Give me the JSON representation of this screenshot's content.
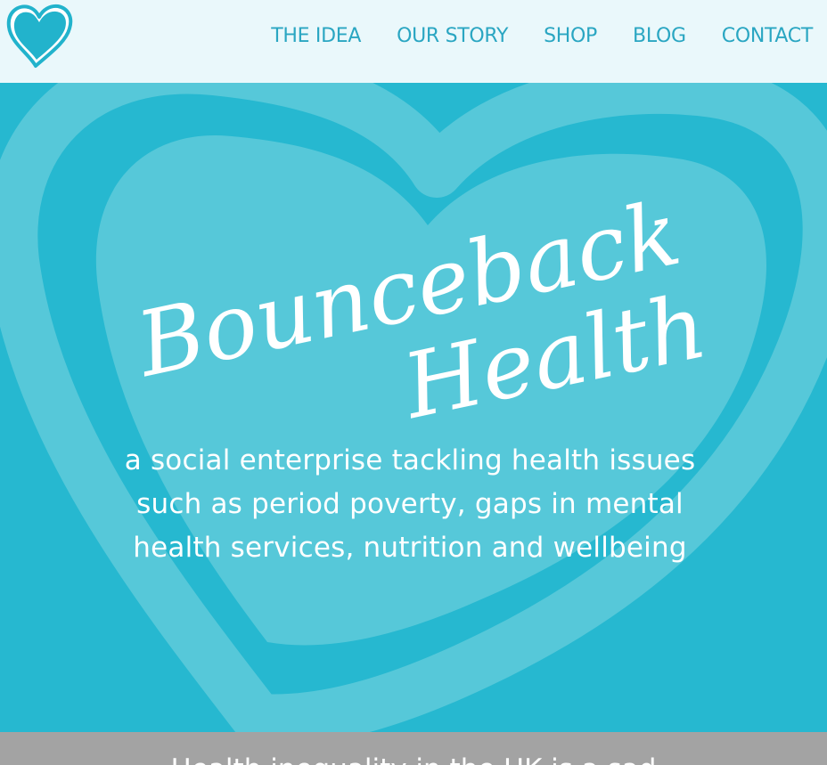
{
  "header": {
    "nav": [
      {
        "label": "THE IDEA"
      },
      {
        "label": "OUR STORY"
      },
      {
        "label": "SHOP"
      },
      {
        "label": "BLOG"
      },
      {
        "label": "CONTACT"
      }
    ]
  },
  "hero": {
    "brand_line1": "Bounceback",
    "brand_line2": "Health",
    "tagline": "a social enterprise tackling health issues such as period poverty, gaps in mental health services, nutrition and wellbeing"
  },
  "band": {
    "text": "Health inequality in the UK is a sad"
  },
  "icons": {
    "logo": "heart-icon",
    "hero_background": "heart-outline-icon"
  },
  "colors": {
    "brand": "#26b8d0",
    "nav_text": "#2aa6c2",
    "header_bg": "#eaf8fb",
    "band_bg": "#a3a3a3"
  }
}
